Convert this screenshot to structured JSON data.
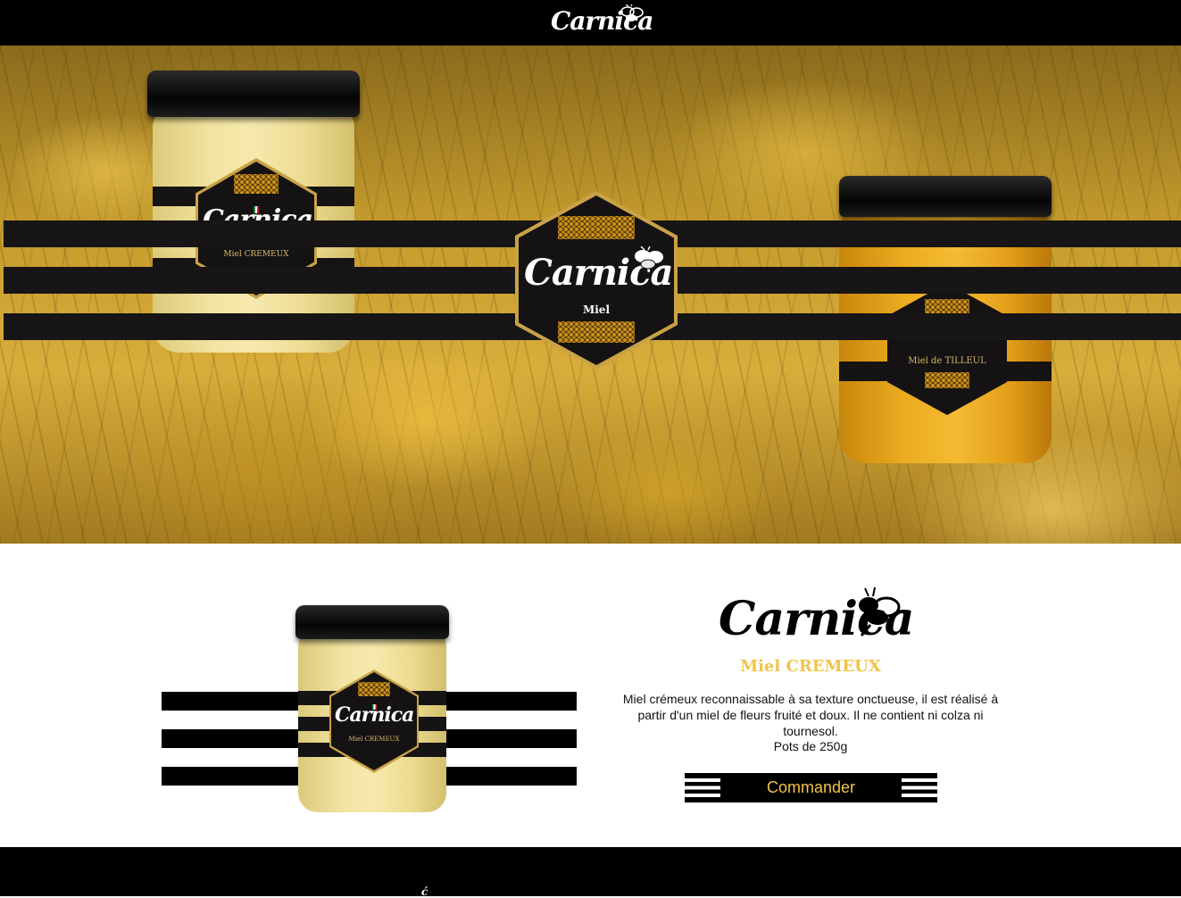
{
  "header": {
    "brand": "Carnica"
  },
  "hero": {
    "left_jar": {
      "brand": "Carnica",
      "label": "Miel CREMEUX"
    },
    "center_badge": {
      "brand": "Carnica",
      "label": "Miel"
    },
    "right_jar": {
      "label": "Miel de TILLEUL"
    }
  },
  "product": {
    "jar": {
      "brand": "Carnica",
      "label": "Miel CREMEUX"
    },
    "brand": "Carnica",
    "subtitle": "Miel CREMEUX",
    "description": "Miel crémeux reconnaissable à sa texture onctueuse, il est réalisé à partir d'un miel de fleurs fruité et doux. Il ne contient ni colza ni tournesol.",
    "pot_size": "Pots de 250g",
    "order_button": "Commander"
  },
  "colors": {
    "black": "#000000",
    "gold": "#f2c447",
    "honey_cream": "#f2e4a2",
    "honey_amber": "#eeb02a"
  },
  "icons": [
    "bee-icon"
  ]
}
